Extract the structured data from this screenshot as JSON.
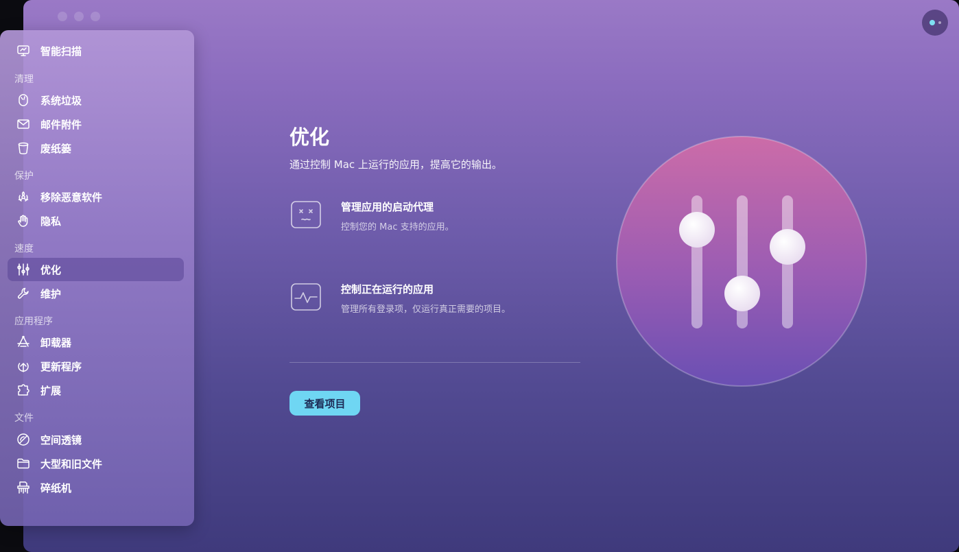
{
  "window": {
    "traffic_lights": [
      "close",
      "minimize",
      "zoom"
    ]
  },
  "sidebar": {
    "items": [
      {
        "label": "智能扫描",
        "icon": "monitor-icon"
      },
      {
        "section": "清理"
      },
      {
        "label": "系统垃圾",
        "icon": "trash-bin-icon"
      },
      {
        "label": "邮件附件",
        "icon": "mail-icon"
      },
      {
        "label": "废纸篓",
        "icon": "bin-icon"
      },
      {
        "section": "保护"
      },
      {
        "label": "移除恶意软件",
        "icon": "biohazard-icon"
      },
      {
        "label": "隐私",
        "icon": "hand-icon"
      },
      {
        "section": "速度"
      },
      {
        "label": "优化",
        "icon": "sliders-icon",
        "active": true
      },
      {
        "label": "维护",
        "icon": "wrench-icon"
      },
      {
        "section": "应用程序"
      },
      {
        "label": "卸载器",
        "icon": "uninstaller-icon"
      },
      {
        "label": "更新程序",
        "icon": "update-icon"
      },
      {
        "label": "扩展",
        "icon": "puzzle-icon"
      },
      {
        "section": "文件"
      },
      {
        "label": "空间透镜",
        "icon": "lens-icon"
      },
      {
        "label": "大型和旧文件",
        "icon": "folder-icon"
      },
      {
        "label": "碎纸机",
        "icon": "shredder-icon"
      }
    ]
  },
  "main": {
    "title": "优化",
    "subtitle": "通过控制 Mac 上运行的应用，提高它的输出。",
    "features": [
      {
        "title": "管理应用的启动代理",
        "desc": "控制您的 Mac 支持的应用。",
        "icon": "launch-agent-icon"
      },
      {
        "title": "控制正在运行的应用",
        "desc": "管理所有登录项，仅运行真正需要的项目。",
        "icon": "activity-icon"
      }
    ],
    "view_button": "查看项目"
  },
  "colors": {
    "accent_button": "#6fd6f3",
    "hero_top": "#c96aa8",
    "hero_bottom": "#6a4fb3"
  }
}
